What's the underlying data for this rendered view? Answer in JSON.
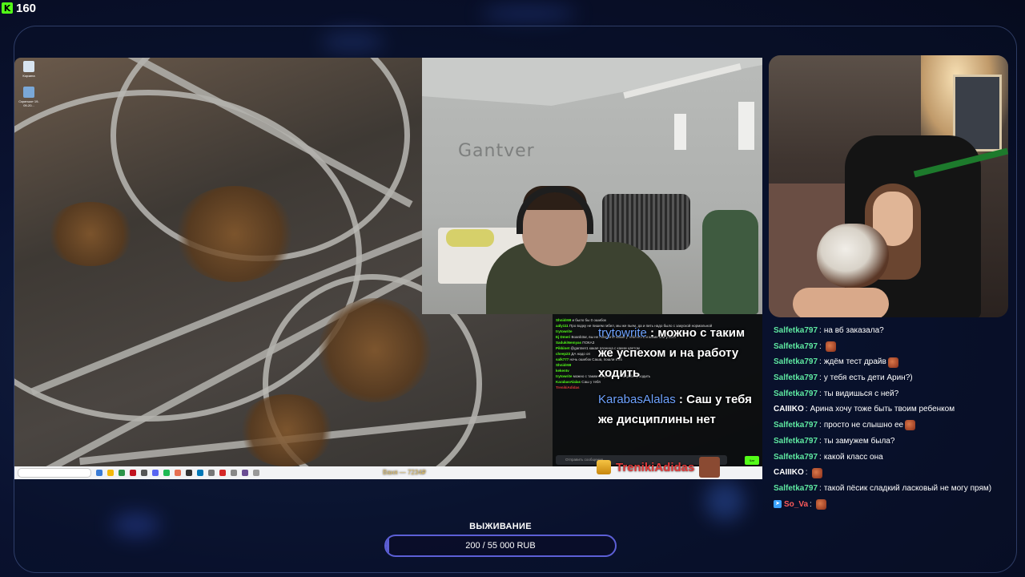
{
  "viewer_count": "160",
  "desktop": {
    "icons": [
      {
        "label": "Корзина",
        "icon": "recycle-bin-icon"
      },
      {
        "label": "Скриншот 19-09-20...",
        "icon": "screenshot-file-icon"
      }
    ],
    "taskbar_overlay_text": "Ваня — 7234₽"
  },
  "webcam_1": {
    "wall_sign": "Gantver"
  },
  "kick_chat": {
    "lines": [
      {
        "user": "Shnidr69",
        "text": "и было бы 0 ошибок"
      },
      {
        "user": "a4ly111",
        "text": "Про водку не пишем гибел, мы же пьем, да и пить надо было с закуской нормальной"
      },
      {
        "user": "trytowrite",
        "text": ""
      },
      {
        "user": "Ej Dmeri",
        "text": "Boanb3ar, вы не поверите какие у тебя есть и какие они у кого"
      },
      {
        "user": "SadukiNemyas",
        "text": "ПОКАЗ"
      },
      {
        "user": "Pikkinet",
        "text": "@gantver1 какая разница с каким цветом"
      },
      {
        "user": "cheep23",
        "text": "ДА надо оп"
      },
      {
        "user": "salk777",
        "text": "ночь ошибок Саша, пошли в кб"
      },
      {
        "user": "Shnidr69",
        "text": ""
      },
      {
        "user": "kekentv",
        "text": ""
      },
      {
        "user": "trytowrite",
        "text": "можно с таким же успехом и на работу ходить"
      },
      {
        "user": "KarabasAlalas",
        "text": "Саш у тебя"
      },
      {
        "user": "TrenikiAdidas",
        "text": ""
      }
    ],
    "input_placeholder": "Отправить сообщение",
    "send_label": "Чат",
    "overlay_user_1": "trytowrite",
    "overlay_text_1": "можно с таким же успехом и на работу ходить",
    "overlay_user_2": "KarabasAlalas",
    "overlay_text_2": "Саш у тебя же дисциплины нет"
  },
  "donation": {
    "name": "TrenikiAdidas"
  },
  "chat": [
    {
      "user": "Salfetka797",
      "text": "на вб заказала?",
      "emote": false,
      "style": "green"
    },
    {
      "user": "Salfetka797",
      "text": "",
      "emote": true,
      "style": "green"
    },
    {
      "user": "Salfetka797",
      "text": "ждём тест драйв",
      "emote": true,
      "style": "green"
    },
    {
      "user": "Salfetka797",
      "text": "у тебя есть дети Арин?)",
      "emote": false,
      "style": "green"
    },
    {
      "user": "Salfetka797",
      "text": "ты видишься с ней?",
      "emote": false,
      "style": "green"
    },
    {
      "user": "CAIIIKO",
      "text": "Арина хочу тоже быть твоим ребенком",
      "emote": false,
      "style": "white"
    },
    {
      "user": "Salfetka797",
      "text": "просто не слышно ее",
      "emote": true,
      "style": "green"
    },
    {
      "user": "Salfetka797",
      "text": "ты замужем была?",
      "emote": false,
      "style": "green"
    },
    {
      "user": "Salfetka797",
      "text": "какой класс она",
      "emote": false,
      "style": "green"
    },
    {
      "user": "CAIIIKO",
      "text": "",
      "emote": true,
      "style": "white"
    },
    {
      "user": "Salfetka797",
      "text": "такой пёсик сладкий ласковый не могу прям)",
      "emote": false,
      "style": "green"
    },
    {
      "user": "So_Va",
      "text": "",
      "emote": true,
      "style": "red"
    }
  ],
  "goal": {
    "label": "ВЫЖИВАНИЕ",
    "progress_text": "200 / 55 000 RUB",
    "progress_fraction": 0.0036,
    "color": "#5c5fd6"
  },
  "colors": {
    "chat_user": "#5ee8a1",
    "kick_green": "#53fc18"
  }
}
